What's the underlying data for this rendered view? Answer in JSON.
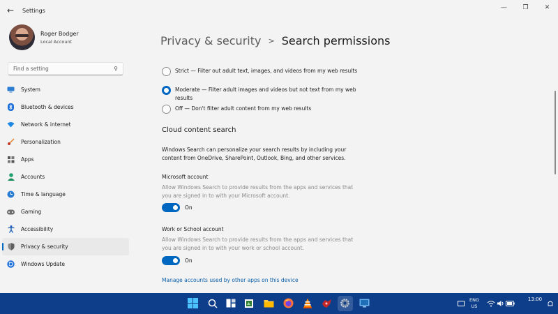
{
  "window": {
    "title": "Settings"
  },
  "profile": {
    "name": "Roger Bodger",
    "account_type": "Local Account"
  },
  "search": {
    "placeholder": "Find a setting"
  },
  "sidebar": {
    "items": [
      {
        "label": "System",
        "icon": "monitor-icon",
        "color": "#2b7cd3"
      },
      {
        "label": "Bluetooth & devices",
        "icon": "bluetooth-icon",
        "color": "#1e6fd9"
      },
      {
        "label": "Network & internet",
        "icon": "wifi-icon",
        "color": "#1e88e5"
      },
      {
        "label": "Personalization",
        "icon": "brush-icon",
        "color": "#e67e22"
      },
      {
        "label": "Apps",
        "icon": "apps-icon",
        "color": "#555555"
      },
      {
        "label": "Accounts",
        "icon": "person-icon",
        "color": "#22a06b"
      },
      {
        "label": "Time & language",
        "icon": "globe-clock-icon",
        "color": "#2b7cd3"
      },
      {
        "label": "Gaming",
        "icon": "controller-icon",
        "color": "#6b6b6b"
      },
      {
        "label": "Accessibility",
        "icon": "accessibility-icon",
        "color": "#1a5fb4"
      },
      {
        "label": "Privacy & security",
        "icon": "shield-icon",
        "color": "#7a7a7a",
        "active": true
      },
      {
        "label": "Windows Update",
        "icon": "refresh-icon",
        "color": "#1e6fd9"
      }
    ]
  },
  "breadcrumb": {
    "parent": "Privacy & security",
    "separator": ">",
    "current": "Search permissions"
  },
  "safe_search": {
    "options": [
      {
        "label": "Strict — Filter out adult text, images, and videos from my web results",
        "checked": false
      },
      {
        "label": "Moderate — Filter adult images and videos but not text from my web results",
        "checked": true
      },
      {
        "label": "Off — Don't filter adult content from my web results",
        "checked": false
      }
    ]
  },
  "cloud": {
    "title": "Cloud content search",
    "description": "Windows Search can personalize your search results by including your content from OneDrive, SharePoint, Outlook, Bing, and other services.",
    "microsoft": {
      "heading": "Microsoft account",
      "description": "Allow Windows Search to provide results from the apps and services that you are signed in to with your Microsoft account.",
      "toggle": "On"
    },
    "work": {
      "heading": "Work or School account",
      "description": "Allow Windows Search to provide results from the apps and services that you are signed in to with your work or school account.",
      "toggle": "On"
    },
    "link": "Manage accounts used by other apps on this device"
  },
  "taskbar": {
    "language": "ENG",
    "region": "US",
    "time": "13:00",
    "accent": "#0e3d8a"
  },
  "colors": {
    "accent": "#0067c0",
    "background": "#f3f3f3"
  }
}
